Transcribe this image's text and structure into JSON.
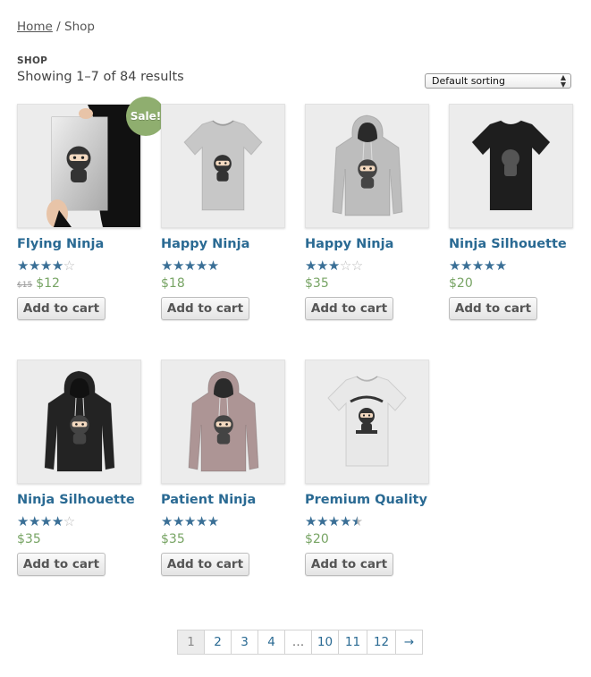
{
  "breadcrumb": {
    "home": "Home",
    "separator": "/",
    "current": "Shop"
  },
  "page_title": "SHOP",
  "result_count": "Showing 1–7 of 84 results",
  "sorting": {
    "selected": "Default sorting"
  },
  "products": [
    {
      "name": "Flying Ninja",
      "rating": 4,
      "price": "$12",
      "old_price": "$15",
      "sale_badge": "Sale!",
      "button": "Add to cart",
      "image": "poster"
    },
    {
      "name": "Happy Ninja",
      "rating": 5,
      "price": "$18",
      "button": "Add to cart",
      "image": "tshirt-grey"
    },
    {
      "name": "Happy Ninja",
      "rating": 3,
      "price": "$35",
      "button": "Add to cart",
      "image": "hoodie-grey"
    },
    {
      "name": "Ninja Silhouette",
      "rating": 5,
      "price": "$20",
      "button": "Add to cart",
      "image": "tshirt-black"
    },
    {
      "name": "Ninja Silhouette",
      "rating": 4,
      "price": "$35",
      "button": "Add to cart",
      "image": "hoodie-black"
    },
    {
      "name": "Patient Ninja",
      "rating": 5,
      "price": "$35",
      "button": "Add to cart",
      "image": "hoodie-pink"
    },
    {
      "name": "Premium Quality",
      "rating": 4.5,
      "price": "$20",
      "button": "Add to cart",
      "image": "tshirt-white"
    }
  ],
  "pagination": [
    "1",
    "2",
    "3",
    "4",
    "…",
    "10",
    "11",
    "12",
    "→"
  ],
  "colors": {
    "link": "#2a6a93",
    "price": "#77a464",
    "sale": "#8fae6f",
    "star": "#3a6f96"
  }
}
